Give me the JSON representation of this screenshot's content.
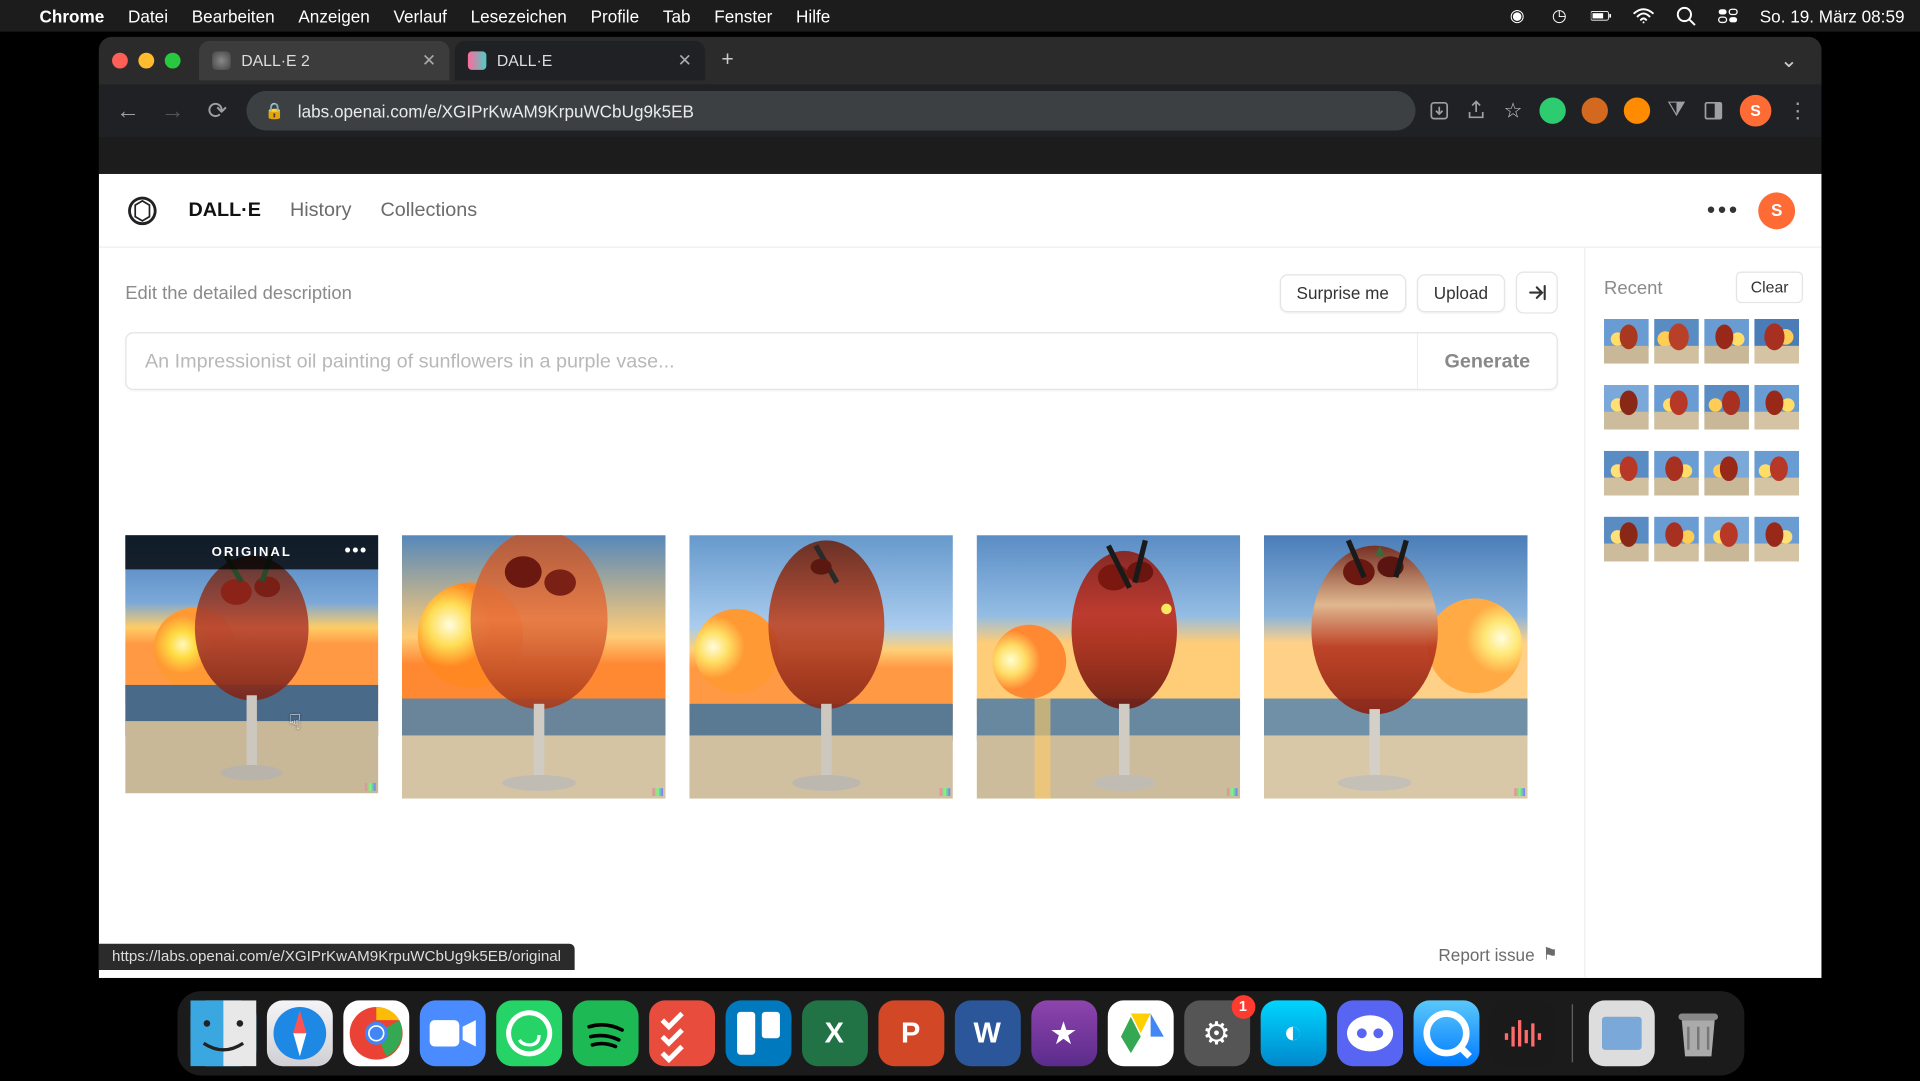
{
  "menubar": {
    "app": "Chrome",
    "items": [
      "Datei",
      "Bearbeiten",
      "Anzeigen",
      "Verlauf",
      "Lesezeichen",
      "Profile",
      "Tab",
      "Fenster",
      "Hilfe"
    ],
    "clock": "So. 19. März  08:59"
  },
  "tabs": [
    {
      "title": "DALL·E 2",
      "active": false
    },
    {
      "title": "DALL·E",
      "active": true
    }
  ],
  "address_url": "labs.openai.com/e/XGIPrKwAM9KrpuWCbUg9k5EB",
  "chrome_avatar": "S",
  "app_nav": {
    "brand": "DALL·E",
    "items": [
      "History",
      "Collections"
    ]
  },
  "app_avatar": "S",
  "prompt": {
    "label": "Edit the detailed description",
    "placeholder": "An Impressionist oil painting of sunflowers in a purple vase...",
    "surprise": "Surprise me",
    "upload": "Upload",
    "generate": "Generate"
  },
  "original_badge": "ORIGINAL",
  "report_label": "Report issue",
  "sidebar": {
    "title": "Recent",
    "clear": "Clear"
  },
  "status_url": "https://labs.openai.com/e/XGIPrKwAM9KrpuWCbUg9k5EB/original",
  "dock_badge": "1"
}
